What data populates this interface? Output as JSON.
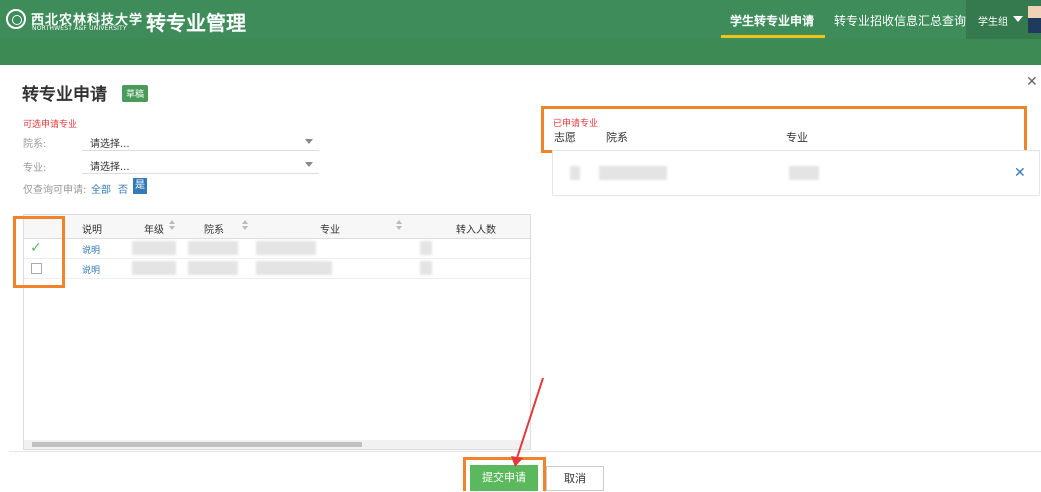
{
  "header": {
    "university_cn": "西北农林科技大学",
    "university_en": "NORTHWEST A&F UNIVERSITY",
    "app_title": "转专业管理",
    "nav": [
      "学生转专业申请",
      "转专业招收信息汇总查询"
    ],
    "active_tab_index": 0,
    "user_name": "学生组"
  },
  "dialog": {
    "title": "转专业申请",
    "status_badge": "草稿",
    "left": {
      "section_label": "可选申请专业",
      "department_label": "院系:",
      "department_value": "请选择...",
      "major_label": "专业:",
      "major_value": "请选择...",
      "filter_label": "仅查询可申请:",
      "filter_all": "全部",
      "filter_no": "否",
      "filter_yes": "是",
      "table_headers": [
        "说明",
        "年级",
        "院系",
        "专业",
        "转入人数"
      ],
      "rows": [
        {
          "checked": true,
          "link": "说明"
        },
        {
          "checked": false,
          "link": "说明"
        }
      ]
    },
    "right": {
      "section_label": "已申请专业",
      "headers": [
        "志愿",
        "院系",
        "专业"
      ]
    },
    "buttons": {
      "submit": "提交申请",
      "cancel": "取消"
    }
  },
  "colors": {
    "header_green": "#3d8c5a",
    "accent_orange": "#f0842c",
    "submit_green": "#5cb85c",
    "link_blue": "#337ab7",
    "label_red": "#e4393c"
  }
}
